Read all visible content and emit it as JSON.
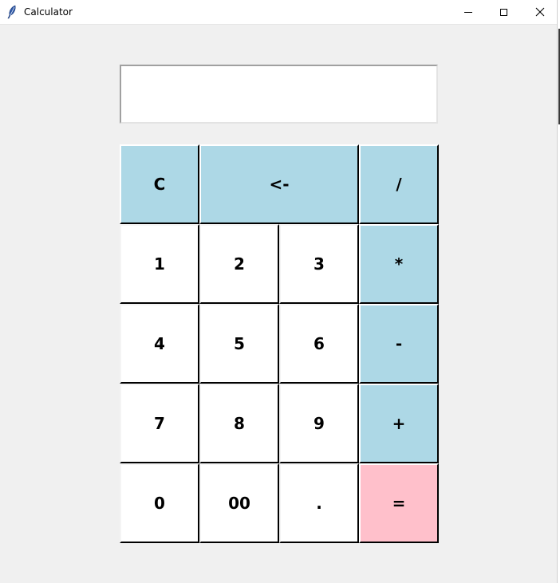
{
  "window": {
    "title": "Calculator"
  },
  "display": {
    "value": ""
  },
  "keys": {
    "clear": "C",
    "backspace": "<-",
    "divide": "/",
    "multiply": "*",
    "subtract": "-",
    "add": "+",
    "equals": "=",
    "one": "1",
    "two": "2",
    "three": "3",
    "four": "4",
    "five": "5",
    "six": "6",
    "seven": "7",
    "eight": "8",
    "nine": "9",
    "zero": "0",
    "double_zero": "00",
    "decimal": "."
  },
  "colors": {
    "operator_key": "#add8e6",
    "equals_key": "#ffc0cb",
    "number_key": "#ffffff",
    "window_background": "#f0f0f0"
  }
}
